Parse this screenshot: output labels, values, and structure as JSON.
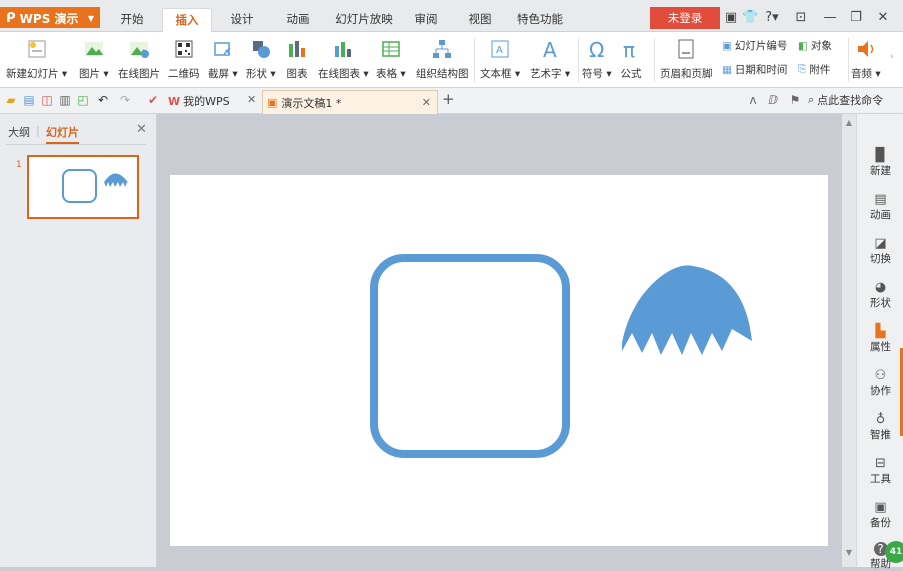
{
  "app": {
    "name": "WPS 演示"
  },
  "menu": {
    "tabs": [
      "开始",
      "插入",
      "设计",
      "动画",
      "幻灯片放映",
      "审阅",
      "视图",
      "特色功能"
    ],
    "active": "插入",
    "login": "未登录"
  },
  "ribbon": {
    "new_slide": "新建幻灯片",
    "picture": "图片",
    "online_picture": "在线图片",
    "qrcode": "二维码",
    "screenshot": "截屏",
    "shape": "形状",
    "chart": "图表",
    "online_chart": "在线图表",
    "table": "表格",
    "org_chart": "组织结构图",
    "textbox": "文本框",
    "wordart": "艺术字",
    "symbol": "符号",
    "formula": "公式",
    "header_footer": "页眉和页脚",
    "slide_number": "幻灯片编号",
    "object": "对象",
    "date_time": "日期和时间",
    "attachment": "附件",
    "audio": "音频"
  },
  "doc_tabs": {
    "my_wps": "我的WPS",
    "document": "演示文稿1 *",
    "command_search": "点此查找命令"
  },
  "left_panel": {
    "tab_outline": "大纲",
    "tab_slides": "幻灯片",
    "slide_number": "1"
  },
  "right_tasks": [
    "新建",
    "动画",
    "切换",
    "形状",
    "属性",
    "协作",
    "智推",
    "工具",
    "备份",
    "帮助"
  ],
  "badge": "41",
  "colors": {
    "accent": "#d8651b",
    "shape_blue": "#5b9bd5",
    "login_red": "#e24c3b",
    "app_orange": "#e8731c"
  }
}
